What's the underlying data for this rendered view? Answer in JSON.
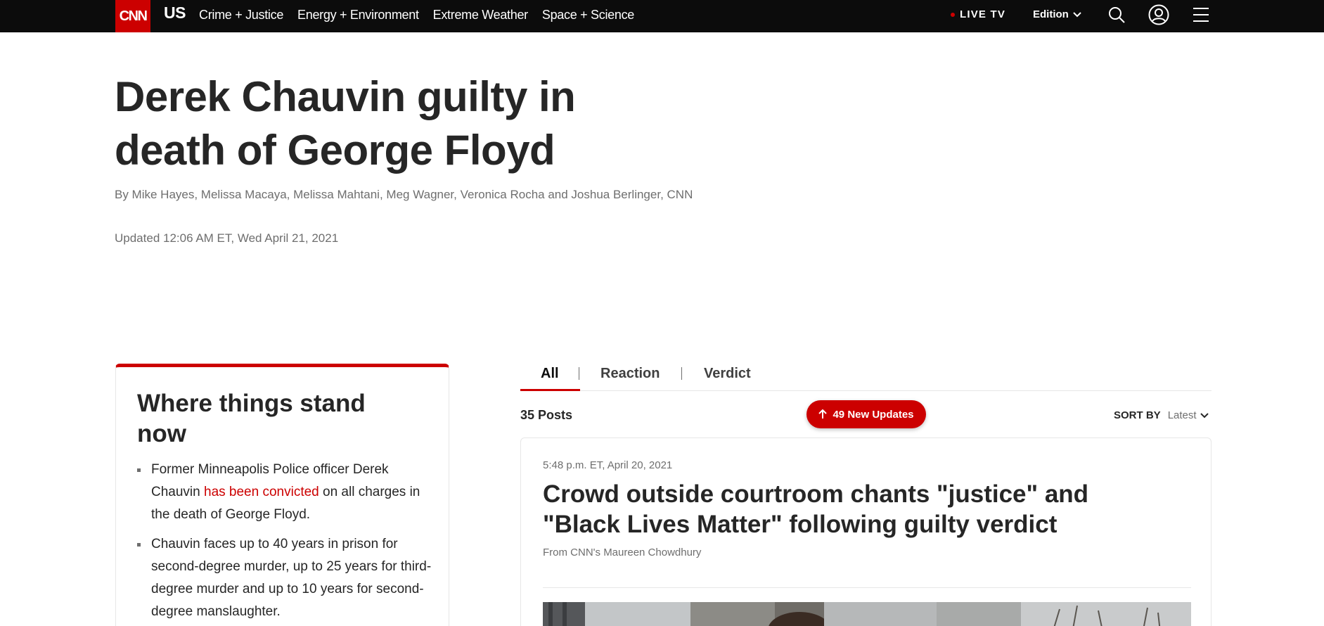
{
  "nav": {
    "logo": "CNN",
    "section": "US",
    "links": [
      "Crime + Justice",
      "Energy + Environment",
      "Extreme Weather",
      "Space + Science"
    ],
    "live_tv": "LIVE TV",
    "edition": "Edition"
  },
  "article": {
    "headline": "Derek Chauvin guilty in death of George Floyd",
    "byline": "By Mike Hayes, Melissa Macaya, Melissa Mahtani, Meg Wagner, Veronica Rocha and Joshua Berlinger, CNN",
    "updated": "Updated 12:06 AM ET, Wed April 21, 2021"
  },
  "where_things_stand": {
    "title": "Where things stand now",
    "item1": {
      "before": "Former Minneapolis Police officer Derek Chauvin ",
      "link": "has been convicted",
      "after": " on all charges in the death of George Floyd."
    },
    "item2": "Chauvin faces up to 40 years in prison for second-degree murder, up to 25 years for third-degree murder and up to 10 years for second-degree manslaughter."
  },
  "feed": {
    "tabs": [
      "All",
      "Reaction",
      "Verdict"
    ],
    "posts_count": "35 Posts",
    "new_updates": "49 New Updates",
    "sort_label": "SORT BY",
    "sort_value": "Latest"
  },
  "post": {
    "time": "5:48 p.m. ET, April 20, 2021",
    "title": "Crowd outside courtroom chants \"justice\" and \"Black Lives Matter\" following guilty verdict",
    "author": "From CNN's Maureen Chowdhury"
  },
  "colors": {
    "brand_red": "#cc0000",
    "nav_bg": "#0c0c0c"
  },
  "icons": [
    "search-icon",
    "account-icon",
    "menu-icon",
    "chevron-down-icon",
    "arrow-up-icon"
  ]
}
